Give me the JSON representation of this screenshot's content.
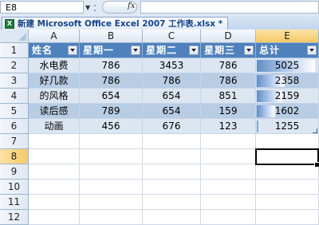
{
  "name_box": "E8",
  "formula_bar": {
    "fx_label": "fx",
    "content": ""
  },
  "workbook_tab": {
    "title": "新建 Microsoft Office Excel 2007 工作表.xlsx *"
  },
  "columns": [
    "A",
    "B",
    "C",
    "D",
    "E"
  ],
  "rows": [
    "1",
    "2",
    "3",
    "4",
    "5",
    "6",
    "7",
    "8",
    "9",
    "10",
    "11",
    "12"
  ],
  "table": {
    "headers": [
      "姓名",
      "星期一",
      "星期二",
      "星期三",
      "总计"
    ],
    "data_rows": [
      {
        "name": "水电费",
        "values": [
          "786",
          "3453",
          "786",
          "5025"
        ],
        "bar_fraction": 0.97
      },
      {
        "name": "好几款",
        "values": [
          "786",
          "786",
          "786",
          "2358"
        ],
        "bar_fraction": 0.46
      },
      {
        "name": "的风格",
        "values": [
          "654",
          "654",
          "851",
          "2159"
        ],
        "bar_fraction": 0.42
      },
      {
        "name": "读后感",
        "values": [
          "789",
          "654",
          "159",
          "1602"
        ],
        "bar_fraction": 0.31
      },
      {
        "name": "动画",
        "values": [
          "456",
          "676",
          "123",
          "1255"
        ],
        "bar_fraction": 0.05
      }
    ]
  },
  "selected_cell": "E8",
  "colors": {
    "table_header": "#4f81bd",
    "band_light": "#dce6f1",
    "band_dark": "#b8cce4",
    "databar": "#638ec6",
    "selection_header": "#f6c966"
  }
}
